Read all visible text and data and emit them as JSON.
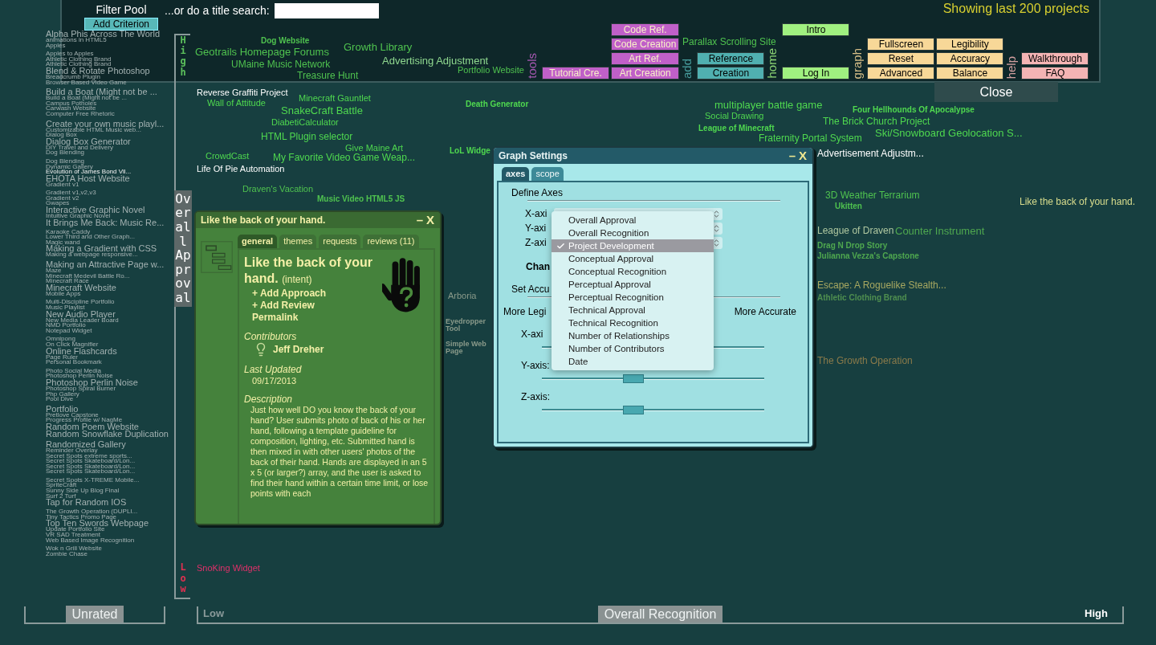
{
  "toolbar": {
    "filter_title": "Filter Pool",
    "add_button": "Add Criterion",
    "search_label": "...or do a title search:",
    "status": "Showing last 200 projects",
    "groups": [
      {
        "label": "tools",
        "color": "#c060c8",
        "buttons": [
          "Code Ref.",
          "Code Creation",
          "Art Ref.",
          "Tutorial Cre.",
          "Art Creation"
        ]
      },
      {
        "label": "add",
        "color": "#50b0b0",
        "buttons": [
          "Reference",
          "Creation"
        ]
      },
      {
        "label": "home",
        "color": "#a0f080",
        "buttons": [
          "Intro",
          "Log In"
        ]
      },
      {
        "label": "graph",
        "color": "#f8d898",
        "buttons": [
          "Fullscreen",
          "Legibility",
          "Reset",
          "Accuracy",
          "Advanced",
          "Balance"
        ]
      },
      {
        "label": "help",
        "color": "#f4b4b4",
        "buttons": [
          "Walkthrough",
          "FAQ"
        ]
      }
    ],
    "close_button": "Close"
  },
  "project_list": [
    [
      {
        "title": "Alpha Phis Across The World",
        "kind": "large"
      },
      {
        "title": "animations in HTML5",
        "kind": "small"
      },
      {
        "title": "Apples",
        "kind": "small"
      }
    ],
    [
      {
        "title": "Apples to Apples",
        "kind": "small"
      },
      {
        "title": "Athletic Clothing Brand",
        "kind": "small"
      },
      {
        "title": "Athletic Clothing Brand",
        "kind": "small"
      },
      {
        "title": "Blend & Rotate Photoshop",
        "kind": "large"
      },
      {
        "title": "Breadcrumb Plugin",
        "kind": "small"
      },
      {
        "title": "Browser Based Video Game",
        "kind": "small"
      }
    ],
    [
      {
        "title": "Build a Boat (Might not be ...",
        "kind": "large"
      },
      {
        "title": "Build a Boat (Might not be ...",
        "kind": "small"
      },
      {
        "title": "Campus Potholes",
        "kind": "small"
      },
      {
        "title": "Carwash Website",
        "kind": "small"
      },
      {
        "title": "Computer Free Rhetoric",
        "kind": "small"
      }
    ],
    [
      {
        "title": "Create your own music playl...",
        "kind": "large"
      },
      {
        "title": "Customizable HTML Music web...",
        "kind": "small"
      },
      {
        "title": "Dialog Box",
        "kind": "small"
      },
      {
        "title": "Dialog Box Generator",
        "kind": "large"
      },
      {
        "title": "DIY Travel and Delivery",
        "kind": "small"
      },
      {
        "title": "Dog Blending",
        "kind": "small"
      }
    ],
    [
      {
        "title": "Dog Blending",
        "kind": "small"
      },
      {
        "title": "Dynamic Gallery",
        "kind": "small"
      },
      {
        "title": "Evolution of James Bond Vil...",
        "kind": "highlight"
      },
      {
        "title": "EHOTA Host Website",
        "kind": "large"
      },
      {
        "title": "Gradient v1",
        "kind": "small"
      }
    ],
    [
      {
        "title": "Gradient v1,v2,v3",
        "kind": "small"
      },
      {
        "title": "Gradient v2",
        "kind": "small"
      },
      {
        "title": "Gwapes",
        "kind": "small"
      },
      {
        "title": "Interactive Graphic Novel",
        "kind": "large"
      },
      {
        "title": "Intuitive Graphic Novel",
        "kind": "small"
      },
      {
        "title": "It Brings Me Back: Music Re...",
        "kind": "large"
      }
    ],
    [
      {
        "title": "Karaoke Caddy",
        "kind": "small"
      },
      {
        "title": "Lower Third and Other Graph...",
        "kind": "small"
      },
      {
        "title": "Magic wand",
        "kind": "small"
      },
      {
        "title": "Making a Gradient with CSS",
        "kind": "large"
      },
      {
        "title": "Making a webpage responsive...",
        "kind": "small"
      }
    ],
    [
      {
        "title": "Making an Attractive Page w...",
        "kind": "large"
      },
      {
        "title": "Maze",
        "kind": "small"
      },
      {
        "title": "Minecraft Medevil Battle Ro...",
        "kind": "small"
      },
      {
        "title": "Minecraft Race",
        "kind": "small"
      },
      {
        "title": "Minecraft Website",
        "kind": "large"
      },
      {
        "title": "Mobile Apps",
        "kind": "small"
      }
    ],
    [
      {
        "title": "Multi-Discipline Portfolio",
        "kind": "small"
      },
      {
        "title": "Music Playlist",
        "kind": "small"
      },
      {
        "title": "New Audio Player",
        "kind": "large"
      },
      {
        "title": "New Media Leader Board",
        "kind": "small"
      },
      {
        "title": "NMD Portfolio",
        "kind": "small"
      },
      {
        "title": "Notepad Widget",
        "kind": "small"
      }
    ],
    [
      {
        "title": "Omnipong",
        "kind": "small"
      },
      {
        "title": "On Click Magnifier",
        "kind": "small"
      },
      {
        "title": "Online Flashcards",
        "kind": "large"
      },
      {
        "title": "Page Ruler",
        "kind": "small"
      },
      {
        "title": "Personal Bookmark",
        "kind": "small"
      }
    ],
    [
      {
        "title": "Photo Social Media",
        "kind": "small"
      },
      {
        "title": "Photoshop Perlin Noise",
        "kind": "small"
      },
      {
        "title": "Photoshop Perlin Noise",
        "kind": "large"
      },
      {
        "title": "Photoshop Spiral Burner",
        "kind": "small"
      },
      {
        "title": "Php Gallery",
        "kind": "small"
      },
      {
        "title": "Pool Dive",
        "kind": "small"
      }
    ],
    [
      {
        "title": "Portfolio",
        "kind": "large"
      },
      {
        "title": "Pretlove Capstone",
        "kind": "small"
      },
      {
        "title": "Progress Profile w/ NagMe",
        "kind": "small"
      },
      {
        "title": "Random Poem Website",
        "kind": "large"
      },
      {
        "title": "Random Snowflake Duplication",
        "kind": "large"
      }
    ],
    [
      {
        "title": "Randomized Gallery",
        "kind": "large"
      },
      {
        "title": "Reminder Overlay",
        "kind": "small"
      },
      {
        "title": "Secret Spots extreme sports...",
        "kind": "small"
      },
      {
        "title": "Secret Spots Skateboard/Lon...",
        "kind": "small"
      },
      {
        "title": "Secret Spots Skateboard/Lon...",
        "kind": "small"
      },
      {
        "title": "Secret Spots Skateboard/Lon...",
        "kind": "small"
      }
    ],
    [
      {
        "title": "Secret Spots X-TREME Mobile...",
        "kind": "small"
      },
      {
        "title": "SpriteCraft",
        "kind": "small"
      },
      {
        "title": "Sunny Side Up Blog Final",
        "kind": "small"
      },
      {
        "title": "Surf 2 Turf",
        "kind": "small"
      },
      {
        "title": "Tap for Random IOS",
        "kind": "large"
      }
    ],
    [
      {
        "title": "The Growth Operation (DUPLI...",
        "kind": "small"
      },
      {
        "title": "Tiny Tactics Promo Page",
        "kind": "small"
      },
      {
        "title": "Top Ten Swords Webpage",
        "kind": "large"
      },
      {
        "title": "Update Portfolio Site",
        "kind": "small"
      },
      {
        "title": "VR SAD Treatment",
        "kind": "small"
      },
      {
        "title": "Web Based Image Recognition",
        "kind": "small"
      }
    ],
    [
      {
        "title": "Wok n Grill Website",
        "kind": "small"
      },
      {
        "title": "Zombie Chase",
        "kind": "small"
      }
    ]
  ],
  "unrated_label": "Unrated",
  "y_axis": {
    "high": "High",
    "label": "Overall Approval",
    "low": "Low"
  },
  "x_axis": {
    "low": "Low",
    "label": "Overall Recognition",
    "high": "High"
  },
  "plot_titles": [
    {
      "title": "Dog Website",
      "color": "#4fc24f"
    },
    {
      "title": "Geotrails Homepage Forums",
      "color": "#4fc24f"
    },
    {
      "title": "UMaine Music Network",
      "color": "#4fc24f"
    },
    {
      "title": "Growth Library",
      "color": "#4fc24f"
    },
    {
      "title": "Advertising Adjustment",
      "color": "#8fd88f"
    },
    {
      "title": "Treasure Hunt",
      "color": "#4fc24f"
    },
    {
      "title": "Portfolio Website",
      "color": "#4fc24f"
    },
    {
      "title": "Parallax Scrolling Site",
      "color": "#4fc24f"
    },
    {
      "title": "Reverse Graffiti Project",
      "color": "#ffffff"
    },
    {
      "title": "Wall of Attitude",
      "color": "#4fd84f"
    },
    {
      "title": "Minecraft Gauntlet",
      "color": "#4fd84f"
    },
    {
      "title": "SnakeCraft Battle",
      "color": "#4fd84f"
    },
    {
      "title": "Death Generator",
      "color": "#4fd84f"
    },
    {
      "title": "DiabetiCalculator",
      "color": "#4fd84f"
    },
    {
      "title": "HTML Plugin selector",
      "color": "#4fd84f"
    },
    {
      "title": "Give Maine Art",
      "color": "#4fd84f"
    },
    {
      "title": "CrowdCast",
      "color": "#4fd84f"
    },
    {
      "title": "My Favorite Video Game Weap...",
      "color": "#4fd84f"
    },
    {
      "title": "Life Of Pie Automation",
      "color": "#ffffff"
    },
    {
      "title": "Draven's Vacation",
      "color": "#4fc24f"
    },
    {
      "title": "Music Video HTML5 JS",
      "color": "#4fc24f"
    },
    {
      "title": "LoL Widge",
      "color": "#4fd84f"
    },
    {
      "title": "multiplayer battle game",
      "color": "#4fd84f"
    },
    {
      "title": "Social Drawing",
      "color": "#4fd84f"
    },
    {
      "title": "Four Hellhounds Of Apocalypse",
      "color": "#4fd84f"
    },
    {
      "title": "The Brick Church Project",
      "color": "#4fd84f"
    },
    {
      "title": "League of Minecraft",
      "color": "#4fd84f"
    },
    {
      "title": "Ski/Snowboard Geolocation S...",
      "color": "#4fd84f"
    },
    {
      "title": "Fraternity Portal System",
      "color": "#4fd84f"
    },
    {
      "title": "Advertisement Adjustm...",
      "color": "#ffffff"
    },
    {
      "title": "3D Weather Terrarium",
      "color": "#4fc24f"
    },
    {
      "title": "Ukitten",
      "color": "#4fc24f"
    },
    {
      "title": "Like the back of your hand.",
      "color": "#d8dc8c"
    },
    {
      "title": "League of Draven",
      "color": "#b0c8a0"
    },
    {
      "title": "Counter Instrument",
      "color": "#4fa84f"
    },
    {
      "title": "Drag N Drop Story",
      "color": "#4fa84f"
    },
    {
      "title": "Julianna Vezza's Capstone",
      "color": "#4fa84f"
    },
    {
      "title": "Escape: A Roguelike Stealth...",
      "color": "#a8a860"
    },
    {
      "title": "Athletic Clothing Brand",
      "color": "#4f8f4f"
    },
    {
      "title": "The Growth Operation",
      "color": "#8a7a4a"
    },
    {
      "title": "Arboria",
      "color": "#8a9a8a"
    },
    {
      "title": "Eyedropper Tool",
      "color": "#8a9a8a"
    },
    {
      "title": "Simple Web Page",
      "color": "#8a9a8a"
    },
    {
      "title": "SnoKing Widget",
      "color": "#e0306a"
    }
  ],
  "project_dialog": {
    "title": "Like the back of your hand.",
    "minimize": "–",
    "close": "X",
    "tabs": [
      {
        "label": "general",
        "selected": true
      },
      {
        "label": "themes",
        "selected": false
      },
      {
        "label": "requests",
        "selected": false
      },
      {
        "label": "reviews (11)",
        "selected": false
      }
    ],
    "heading": "Like the back of your hand.",
    "heading_note": "(intent)",
    "links": [
      "+ Add Approach",
      "+ Add Review",
      "Permalink"
    ],
    "contributors_label": "Contributors",
    "contributors": [
      "Jeff Dreher"
    ],
    "updated_label": "Last Updated",
    "updated": "09/17/2013",
    "description_label": "Description",
    "description": "Just how well DO you know the back of your hand? User submits photo of back of his or her hand, following a template guideline for composition, lighting, etc. Submitted hand is then mixed in with other users' photos of the back of their hand. Hands are displayed in an 5 x 5 (or larger?) array, and the user is asked to find their hand within a certain time limit, or lose points with each"
  },
  "graph_settings": {
    "title": "Graph Settings",
    "minimize": "–",
    "close": "X",
    "tabs": [
      {
        "label": "axes",
        "selected": true
      },
      {
        "label": "scope",
        "selected": false
      }
    ],
    "section": "Define Axes",
    "axis_labels": [
      "X-axi",
      "Y-axi",
      "Z-axi"
    ],
    "change_label": "Chan",
    "accuracy_label": "Set Accu",
    "scale_left": "More Legi",
    "scale_right": "More Accurate",
    "sliders": [
      {
        "label": "X-axi"
      },
      {
        "label": "Y-axis:",
        "level": 0.41
      },
      {
        "label": "Z-axis:",
        "level": 0.41
      }
    ],
    "axis_menu": [
      {
        "label": "Overall Approval",
        "selected": false
      },
      {
        "label": "Overall Recognition",
        "selected": false
      },
      {
        "label": "Project Development",
        "selected": true
      },
      {
        "label": "Conceptual Approval",
        "selected": false
      },
      {
        "label": "Conceptual Recognition",
        "selected": false
      },
      {
        "label": "Perceptual Approval",
        "selected": false
      },
      {
        "label": "Perceptual Recognition",
        "selected": false
      },
      {
        "label": "Technical Approval",
        "selected": false
      },
      {
        "label": "Technical Recognition",
        "selected": false
      },
      {
        "label": "Number of Relationships",
        "selected": false
      },
      {
        "label": "Number of Contributors",
        "selected": false
      },
      {
        "label": "Date",
        "selected": false
      }
    ]
  }
}
